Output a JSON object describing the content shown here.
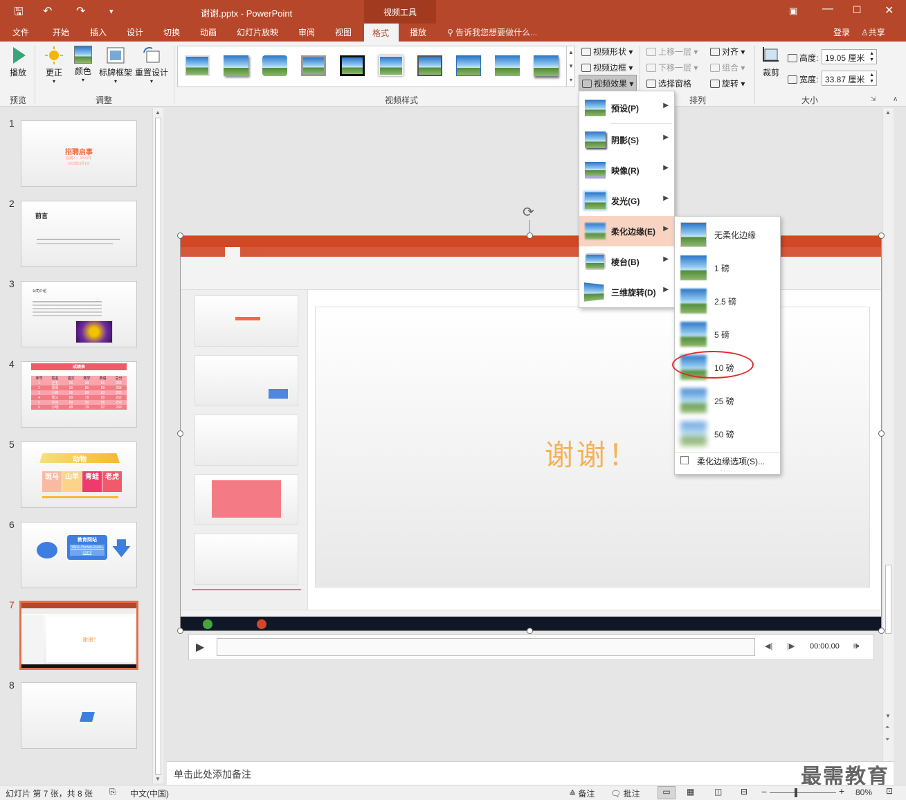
{
  "title_bar": {
    "doc_title": "谢谢.pptx - PowerPoint",
    "context_tab": "视频工具"
  },
  "menu": {
    "items": [
      "文件",
      "开始",
      "插入",
      "设计",
      "切换",
      "动画",
      "幻灯片放映",
      "审阅",
      "视图",
      "格式",
      "播放"
    ],
    "active": "格式",
    "tell_me": "告诉我您想要做什么...",
    "login": "登录",
    "share": "共享"
  },
  "ribbon": {
    "preview": {
      "play": "播放",
      "group": "预览"
    },
    "adjust": {
      "correct": "更正",
      "color": "颜色",
      "poster": "标牌框架",
      "reset": "重置设计",
      "group": "调整"
    },
    "video_styles": {
      "group": "视频样式",
      "shape": "视频形状",
      "border": "视频边框",
      "effects": "视频效果"
    },
    "arrange": {
      "bring_forward": "上移一层",
      "send_backward": "下移一层",
      "selection_pane": "选择窗格",
      "align": "对齐",
      "group_cmd": "组合",
      "rotate": "旋转",
      "group": "排列"
    },
    "size": {
      "crop": "裁剪",
      "height_label": "高度:",
      "height_value": "19.05 厘米",
      "width_label": "宽度:",
      "width_value": "33.87 厘米",
      "group": "大小"
    }
  },
  "effects_menu": {
    "items": [
      {
        "label": "预设(P)"
      },
      {
        "label": "阴影(S)"
      },
      {
        "label": "映像(R)"
      },
      {
        "label": "发光(G)"
      },
      {
        "label": "柔化边缘(E)"
      },
      {
        "label": "棱台(B)"
      },
      {
        "label": "三维旋转(D)"
      }
    ],
    "highlighted": "柔化边缘(E)"
  },
  "soft_edges_menu": {
    "items": [
      "无柔化边缘",
      "1 磅",
      "2.5 磅",
      "5 磅",
      "10 磅",
      "25 磅",
      "50 磅"
    ],
    "circled": "10 磅",
    "options": "柔化边缘选项(S)..."
  },
  "slides": [
    {
      "num": "1",
      "title": "招聘启事",
      "lines": [
        "招聘人：XX公司",
        "2018年3月1日"
      ]
    },
    {
      "num": "2",
      "title": "前言"
    },
    {
      "num": "3",
      "title": "公司介绍"
    },
    {
      "num": "4",
      "title": "成绩表",
      "headers": [
        "序号",
        "姓名",
        "语文",
        "数学",
        "英语",
        "总分"
      ],
      "rows": [
        [
          "1",
          "王五",
          "96",
          "90",
          "81",
          "269"
        ],
        [
          "2",
          "周周",
          "95",
          "85",
          "88",
          "268"
        ],
        [
          "3",
          "小四",
          "96",
          "88",
          "83",
          "265"
        ],
        [
          "4",
          "张三",
          "89",
          "78",
          "85",
          "252"
        ],
        [
          "5",
          "大中",
          "80",
          "90",
          "86",
          "256"
        ],
        [
          "6",
          "小明",
          "88",
          "79",
          "82",
          "249"
        ]
      ]
    },
    {
      "num": "5",
      "title": "动物",
      "animals": [
        "斑马",
        "山羊",
        "青蛙",
        "老虎"
      ]
    },
    {
      "num": "6",
      "box_title": "教育网站",
      "link": "https://www.zuixu.com/"
    },
    {
      "num": "7",
      "text": "谢谢！"
    },
    {
      "num": "8"
    }
  ],
  "video": {
    "slide_text": "谢谢！",
    "time": "00:00.00"
  },
  "notes_placeholder": "单击此处添加备注",
  "status": {
    "slide_info": "幻灯片 第 7 张，共 8 张",
    "language": "中文(中国)",
    "notes": "备注",
    "comments": "批注",
    "zoom": "80%"
  },
  "watermark": "最需教育"
}
